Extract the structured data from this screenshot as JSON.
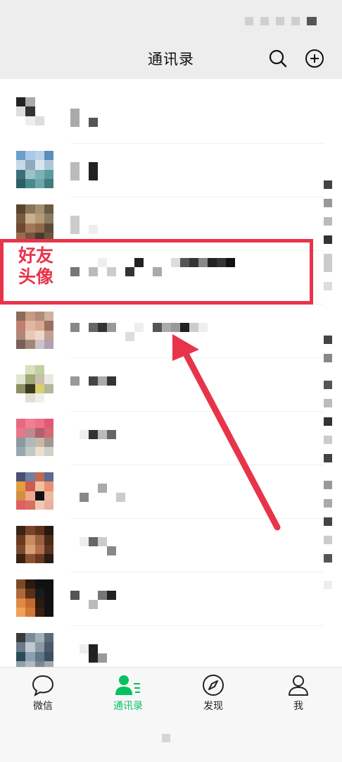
{
  "header": {
    "title": "通讯录"
  },
  "annotation": {
    "label_line1": "好友",
    "label_line2": "头像",
    "color": "#e8344b"
  },
  "tabs": [
    {
      "label": "微信",
      "icon": "chat-bubble-icon",
      "active": false
    },
    {
      "label": "通讯录",
      "icon": "contacts-person-icon",
      "active": true
    },
    {
      "label": "发现",
      "icon": "compass-icon",
      "active": false
    },
    {
      "label": "我",
      "icon": "profile-person-icon",
      "active": false
    }
  ],
  "colors": {
    "accent": "#07c160",
    "annotation": "#e8344b",
    "header_bg": "#ededed"
  }
}
